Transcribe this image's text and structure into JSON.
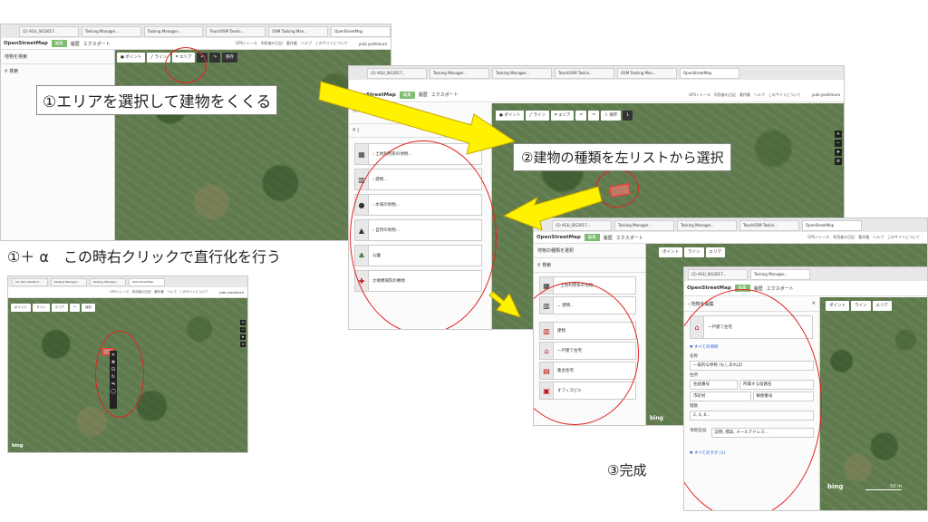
{
  "captions": {
    "step1": "①エリアを選択して建物をくくる",
    "step2": "②建物の種類を左リストから選択",
    "step1_alpha": "①＋ α　この時右クリックで直行化を行う",
    "step3": "③完成"
  },
  "browser_tabs": [
    "(2) AGU_SIG2017...",
    "Tasking Manager...",
    "Tasking Manager...",
    "TeachOSM Taskin...",
    "OSM Tasking Man...",
    "OpenStreetMap"
  ],
  "osm": {
    "logo": "OpenStreetMap",
    "edit": "編集",
    "history": "履歴",
    "export": "エクスポート",
    "nav": "GPSトレース　利用者の日記　著作権　ヘルプ　このサイトについて",
    "user": "yuta yoshimura"
  },
  "sidebar": {
    "search_features": "地物を検索",
    "search": "検索",
    "select_type": "地物の種類を選択"
  },
  "toolbar": {
    "point": "ポイント",
    "line": "ライン",
    "area": "エリア",
    "save": "保存",
    "save_count": "1"
  },
  "preset_list": [
    {
      "icon": "land-use-icon",
      "glyph": "▦",
      "label": "土地利用系の地物..."
    },
    {
      "icon": "building-icon",
      "glyph": "▥",
      "label": "建物..."
    },
    {
      "icon": "water-icon",
      "glyph": "●",
      "label": "水域の地物..."
    },
    {
      "icon": "nature-icon",
      "glyph": "▲",
      "label": "自然の地物..."
    },
    {
      "icon": "park-icon",
      "glyph": "♣",
      "label": "公園"
    },
    {
      "icon": "hospital-icon",
      "glyph": "✚",
      "label": "大規模病院の敷地"
    }
  ],
  "building_list": {
    "group1": "土地利用系の地物...",
    "group2": "建物...",
    "items": [
      {
        "icon": "building-icon",
        "label": "建物"
      },
      {
        "icon": "house-icon",
        "label": "一戸建て住宅"
      },
      {
        "icon": "apartments-icon",
        "label": "集合住宅"
      },
      {
        "icon": "office-icon",
        "label": "オフィスビル"
      }
    ]
  },
  "feature_editor": {
    "header": "地物を編集",
    "preset": "一戸建て住宅",
    "all_fields": "▼ すべての項目",
    "name_label": "名称",
    "name_placeholder": "一般的な呼称 (もしあれば)",
    "address_label": "住所",
    "housenumber": "住居番号",
    "street": "所属する街路名",
    "city": "市町村",
    "postcode": "郵便番号",
    "levels_label": "階数",
    "levels_placeholder": "2, 4, 6...",
    "features_label": "項目追加:",
    "features_value": "説明, 標高, メールアドレス...",
    "all_tags": "▼ すべてのタグ (1)"
  },
  "map": {
    "bing": "bing",
    "scale": "50 m"
  }
}
